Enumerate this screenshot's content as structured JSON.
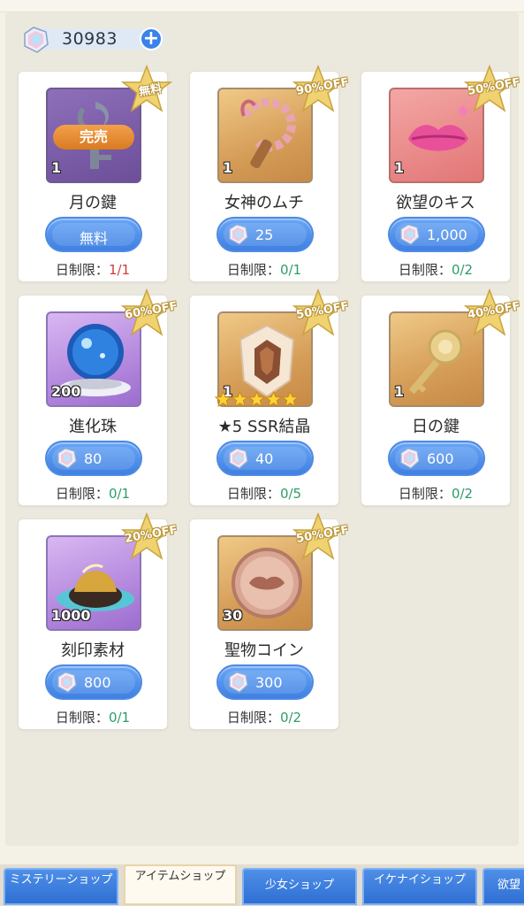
{
  "currency": {
    "amount": "30983",
    "icon": "crystal-gem-icon",
    "add_icon": "plus-icon"
  },
  "items": [
    {
      "name": "月の鍵",
      "qty": "1",
      "badge": "無料",
      "price": "無料",
      "free": true,
      "sold_out": "完売",
      "limit_label": "日制限：",
      "limit": "1/1",
      "limit_full": true,
      "icon": "moon-key-icon"
    },
    {
      "name": "女神のムチ",
      "qty": "1",
      "badge": "90%OFF",
      "price": "25",
      "limit_label": "日制限：",
      "limit": "0/1",
      "icon": "whip-icon"
    },
    {
      "name": "欲望のキス",
      "qty": "1",
      "badge": "50%OFF",
      "price": "1,000",
      "limit_label": "日制限：",
      "limit": "0/2",
      "icon": "lips-icon"
    },
    {
      "name": "進化珠",
      "qty": "200",
      "badge": "60%OFF",
      "price": "80",
      "limit_label": "日制限：",
      "limit": "0/1",
      "icon": "crystal-orb-icon"
    },
    {
      "name": "★5 SSR結晶",
      "qty": "1",
      "badge": "50%OFF",
      "price": "40",
      "limit_label": "日制限：",
      "limit": "0/5",
      "icon": "ssr-crystal-icon",
      "stars": 5
    },
    {
      "name": "日の鍵",
      "qty": "1",
      "badge": "40%OFF",
      "price": "600",
      "limit_label": "日制限：",
      "limit": "0/2",
      "icon": "sun-key-icon"
    },
    {
      "name": "刻印素材",
      "qty": "1000",
      "badge": "20%OFF",
      "price": "800",
      "limit_label": "日制限：",
      "limit": "0/1",
      "icon": "engraving-material-icon"
    },
    {
      "name": "聖物コイン",
      "qty": "30",
      "badge": "50%OFF",
      "price": "300",
      "limit_label": "日制限：",
      "limit": "0/2",
      "icon": "holy-coin-icon"
    }
  ],
  "tabs": [
    {
      "label": "ミステリーショップ"
    },
    {
      "label": "アイテムショップ",
      "active": true
    },
    {
      "label": "少女ショップ"
    },
    {
      "label": "イケナイショップ"
    },
    {
      "label": "欲望"
    }
  ],
  "colors": {
    "button_blue": "#3f80e2",
    "limit_ok": "#2e9c6a",
    "limit_full": "#d33a3a",
    "badge_gold": "#e8c45a"
  }
}
